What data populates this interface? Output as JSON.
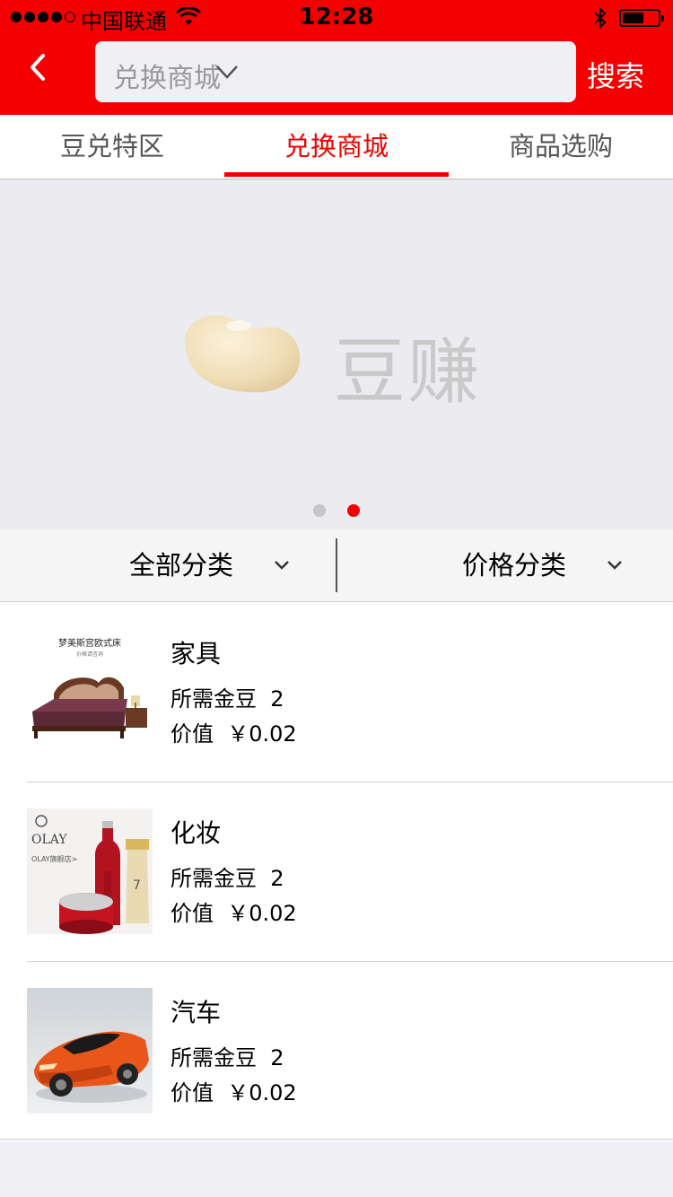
{
  "status_bar": {
    "carrier": "中国联通",
    "time": "12:28",
    "battery_level": 0.6
  },
  "nav": {
    "back_icon": "chevron-left-icon",
    "search_text": "兑换商城",
    "search_caret_icon": "chevron-down-icon",
    "search_button": "搜索"
  },
  "tabs": [
    {
      "label": "豆兑特区",
      "active": false
    },
    {
      "label": "兑换商城",
      "active": true
    },
    {
      "label": "商品选购",
      "active": false
    }
  ],
  "banner": {
    "text": "豆赚",
    "pages": 2,
    "current_page": 2
  },
  "filters": {
    "category": "全部分类",
    "price": "价格分类"
  },
  "products": [
    {
      "name": "家具",
      "beans_label": "所需金豆",
      "beans": "2",
      "value_label": "价值",
      "value": "￥0.02",
      "thumb_caption": "梦美斯宫欧式床",
      "thumb_subcaption": "价格请咨询"
    },
    {
      "name": "化妆",
      "beans_label": "所需金豆",
      "beans": "2",
      "value_label": "价值",
      "value": "￥0.02",
      "thumb_caption": "OLAY",
      "thumb_subcaption": "OLAY旗舰店>"
    },
    {
      "name": "汽车",
      "beans_label": "所需金豆",
      "beans": "2",
      "value_label": "价值",
      "value": "￥0.02"
    }
  ],
  "colors": {
    "accent": "#f50000",
    "tab_active": "#f00000",
    "background": "#efeff4"
  }
}
